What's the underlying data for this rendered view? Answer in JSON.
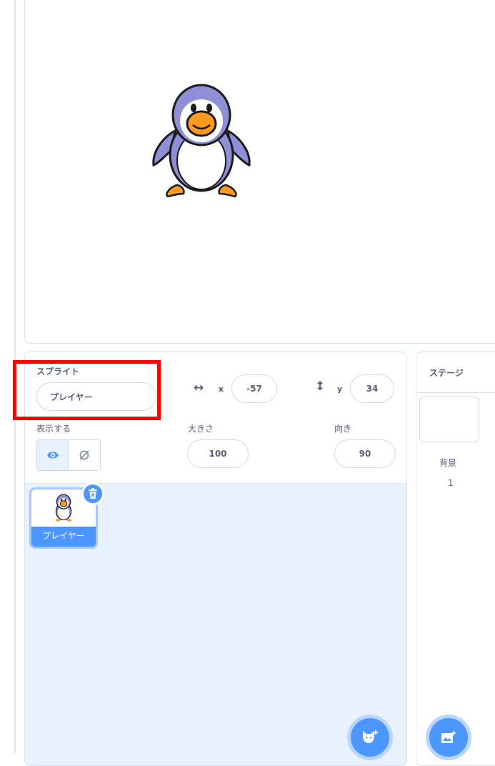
{
  "sprite_info": {
    "sprite_label": "スプライト",
    "sprite_name": "プレイヤー",
    "x_letter": "x",
    "x_value": "-57",
    "y_letter": "y",
    "y_value": "34",
    "show_label": "表示する",
    "size_label": "大きさ",
    "size_value": "100",
    "direction_label": "向き",
    "direction_value": "90"
  },
  "sprites": [
    {
      "name": "プレイヤー",
      "selected": true
    }
  ],
  "stage_pane": {
    "title": "ステージ",
    "backdrops_label": "背景",
    "backdrops_count": "1"
  },
  "colors": {
    "accent": "#4c97ff",
    "highlight_box": "#ff0000",
    "pane_bg": "#e9f1fc"
  },
  "icons": {
    "x_axis": "horizontal-arrows-icon",
    "y_axis": "vertical-arrows-icon",
    "show": "eye-icon",
    "hide": "eye-slash-icon",
    "delete": "trash-icon",
    "add_sprite": "choose-sprite-icon",
    "add_backdrop": "choose-backdrop-icon"
  }
}
